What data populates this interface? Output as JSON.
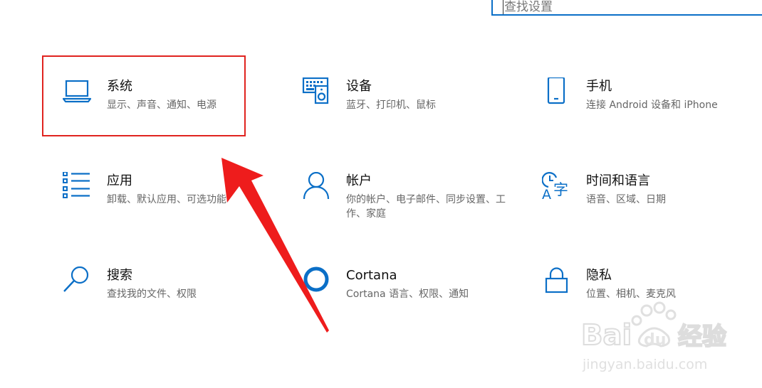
{
  "search": {
    "value": "查找设置"
  },
  "tiles": [
    {
      "key": "system",
      "title": "系统",
      "description": "显示、声音、通知、电源",
      "icon": "laptop-icon"
    },
    {
      "key": "devices",
      "title": "设备",
      "description": "蓝牙、打印机、鼠标",
      "icon": "devices-icon"
    },
    {
      "key": "phone",
      "title": "手机",
      "description": "连接 Android 设备和 iPhone",
      "icon": "phone-icon"
    },
    {
      "key": "apps",
      "title": "应用",
      "description": "卸载、默认应用、可选功能",
      "icon": "apps-list-icon"
    },
    {
      "key": "accounts",
      "title": "帐户",
      "description": "你的帐户、电子邮件、同步设置、工作、家庭",
      "icon": "person-icon"
    },
    {
      "key": "time-language",
      "title": "时间和语言",
      "description": "语音、区域、日期",
      "icon": "time-language-icon"
    },
    {
      "key": "search",
      "title": "搜索",
      "description": "查找我的文件、权限",
      "icon": "search-icon"
    },
    {
      "key": "cortana",
      "title": "Cortana",
      "description": "Cortana 语言、权限、通知",
      "icon": "cortana-ring-icon"
    },
    {
      "key": "privacy",
      "title": "隐私",
      "description": "位置、相机、麦克风",
      "icon": "lock-icon"
    }
  ],
  "watermark": {
    "brand": "Bai du 经验",
    "url": "jingyan.baidu.com"
  },
  "colors": {
    "accent": "#0b6fc7",
    "highlight": "#e0231f",
    "text_primary": "#111111",
    "text_secondary": "#666666",
    "watermark": "#e4e4e4"
  }
}
